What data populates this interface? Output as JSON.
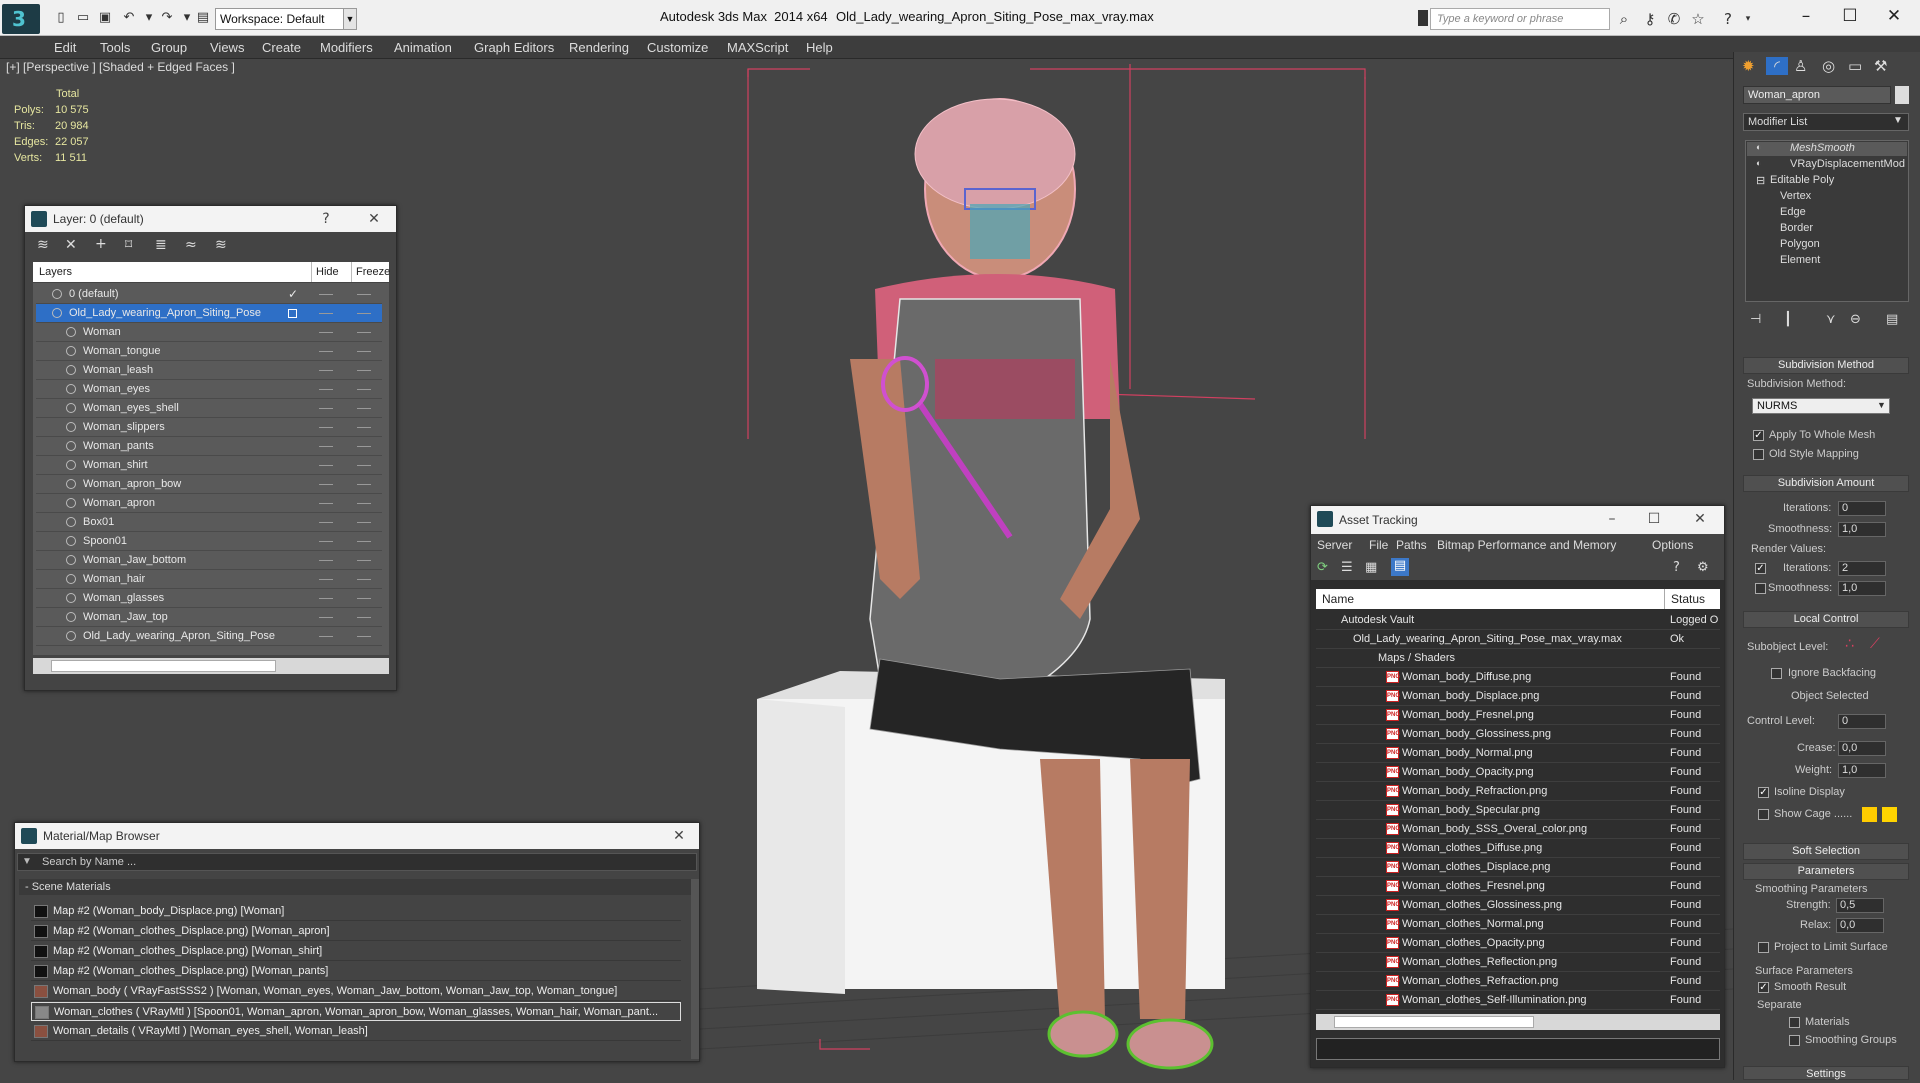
{
  "titlebar": {
    "app": "Autodesk 3ds Max  2014 x64",
    "file": "Old_Lady_wearing_Apron_Siting_Pose_max_vray.max",
    "workspace": "Workspace: Default",
    "search_placeholder": "Type a keyword or phrase"
  },
  "menu": [
    "Edit",
    "Tools",
    "Group",
    "Views",
    "Create",
    "Modifiers",
    "Animation",
    "Graph Editors",
    "Rendering",
    "Customize",
    "MAXScript",
    "Help"
  ],
  "viewport": {
    "label": "[+] [Perspective ] [Shaded + Edged Faces ]",
    "stats_header": "Total",
    "stats": [
      {
        "k": "Polys:",
        "v": "10 575"
      },
      {
        "k": "Tris:",
        "v": "20 984"
      },
      {
        "k": "Edges:",
        "v": "22 057"
      },
      {
        "k": "Verts:",
        "v": "11 511"
      }
    ]
  },
  "layer_panel": {
    "title": "Layer: 0 (default)",
    "col_layers": "Layers",
    "col_hide": "Hide",
    "col_freeze": "Freeze",
    "rows": [
      "0 (default)",
      "Old_Lady_wearing_Apron_Siting_Pose",
      "Woman",
      "Woman_tongue",
      "Woman_leash",
      "Woman_eyes",
      "Woman_eyes_shell",
      "Woman_slippers",
      "Woman_pants",
      "Woman_shirt",
      "Woman_apron_bow",
      "Woman_apron",
      "Box01",
      "Spoon01",
      "Woman_Jaw_bottom",
      "Woman_hair",
      "Woman_glasses",
      "Woman_Jaw_top",
      "Old_Lady_wearing_Apron_Siting_Pose"
    ]
  },
  "material_browser": {
    "title": "Material/Map Browser",
    "search_placeholder": "Search by Name ...",
    "group": "- Scene Materials",
    "rows": [
      "Map #2 (Woman_body_Displace.png) [Woman]",
      "Map #2 (Woman_clothes_Displace.png) [Woman_apron]",
      "Map #2 (Woman_clothes_Displace.png) [Woman_shirt]",
      "Map #2 (Woman_clothes_Displace.png) [Woman_pants]",
      "Woman_body  ( VRayFastSSS2 ) [Woman, Woman_eyes, Woman_Jaw_bottom, Woman_Jaw_top, Woman_tongue]",
      "Woman_clothes  ( VRayMtl ) [Spoon01, Woman_apron, Woman_apron_bow, Woman_glasses, Woman_hair, Woman_pant...",
      "Woman_details  ( VRayMtl ) [Woman_eyes_shell, Woman_leash]"
    ]
  },
  "asset_tracking": {
    "title": "Asset Tracking",
    "menu": [
      "Server",
      "File",
      "Paths",
      "Bitmap Performance and Memory",
      "Options"
    ],
    "col_name": "Name",
    "col_status": "Status",
    "vault": {
      "name": "Autodesk Vault",
      "status": "Logged O"
    },
    "file": {
      "name": "Old_Lady_wearing_Apron_Siting_Pose_max_vray.max",
      "status": "Ok"
    },
    "group": "Maps / Shaders",
    "rows": [
      {
        "n": "Woman_body_Diffuse.png",
        "s": "Found"
      },
      {
        "n": "Woman_body_Displace.png",
        "s": "Found"
      },
      {
        "n": "Woman_body_Fresnel.png",
        "s": "Found"
      },
      {
        "n": "Woman_body_Glossiness.png",
        "s": "Found"
      },
      {
        "n": "Woman_body_Normal.png",
        "s": "Found"
      },
      {
        "n": "Woman_body_Opacity.png",
        "s": "Found"
      },
      {
        "n": "Woman_body_Refraction.png",
        "s": "Found"
      },
      {
        "n": "Woman_body_Specular.png",
        "s": "Found"
      },
      {
        "n": "Woman_body_SSS_Overal_color.png",
        "s": "Found"
      },
      {
        "n": "Woman_clothes_Diffuse.png",
        "s": "Found"
      },
      {
        "n": "Woman_clothes_Displace.png",
        "s": "Found"
      },
      {
        "n": "Woman_clothes_Fresnel.png",
        "s": "Found"
      },
      {
        "n": "Woman_clothes_Glossiness.png",
        "s": "Found"
      },
      {
        "n": "Woman_clothes_Normal.png",
        "s": "Found"
      },
      {
        "n": "Woman_clothes_Opacity.png",
        "s": "Found"
      },
      {
        "n": "Woman_clothes_Reflection.png",
        "s": "Found"
      },
      {
        "n": "Woman_clothes_Refraction.png",
        "s": "Found"
      },
      {
        "n": "Woman_clothes_Self-Illumination.png",
        "s": "Found"
      }
    ]
  },
  "command_panel": {
    "object_name": "Woman_apron",
    "modifier_list": "Modifier List",
    "stack": [
      "MeshSmooth",
      "VRayDisplacementMod",
      "Editable Poly",
      "Vertex",
      "Edge",
      "Border",
      "Polygon",
      "Element"
    ],
    "subdivision_method_hdr": "Subdivision Method",
    "subdivision_method_lbl": "Subdivision Method:",
    "subdivision_method": "NURMS",
    "apply_whole": "Apply To Whole Mesh",
    "old_style": "Old Style Mapping",
    "subdivision_amount_hdr": "Subdivision Amount",
    "iterations": "Iterations:",
    "iterations_val": "0",
    "smoothness": "Smoothness:",
    "smoothness_val": "1,0",
    "render_values": "Render Values:",
    "r_iterations_val": "2",
    "r_smoothness_val": "1,0",
    "local_control_hdr": "Local Control",
    "subobject_level": "Subobject Level:",
    "ignore_backfacing": "Ignore Backfacing",
    "object_selected": "Object Selected",
    "control_level": "Control Level:",
    "control_level_val": "0",
    "crease": "Crease:",
    "crease_val": "0,0",
    "weight": "Weight:",
    "weight_val": "1,0",
    "isoline": "Isoline Display",
    "show_cage": "Show Cage ......",
    "soft_selection_hdr": "Soft Selection",
    "parameters_hdr": "Parameters",
    "smoothing_params": "Smoothing Parameters",
    "strength": "Strength:",
    "strength_val": "0,5",
    "relax": "Relax:",
    "relax_val": "0,0",
    "project_limit": "Project to Limit Surface",
    "surface_params": "Surface Parameters",
    "smooth_result": "Smooth Result",
    "separate": "Separate",
    "materials": "Materials",
    "smoothing_groups": "Smoothing Groups",
    "settings_hdr": "Settings"
  },
  "colors": {
    "accent": "#4fc3d0",
    "selected_row": "#2e6fc6",
    "viewport_bg": "#454545",
    "cage1": "#ffcc00",
    "cage2": "#ffd400"
  }
}
